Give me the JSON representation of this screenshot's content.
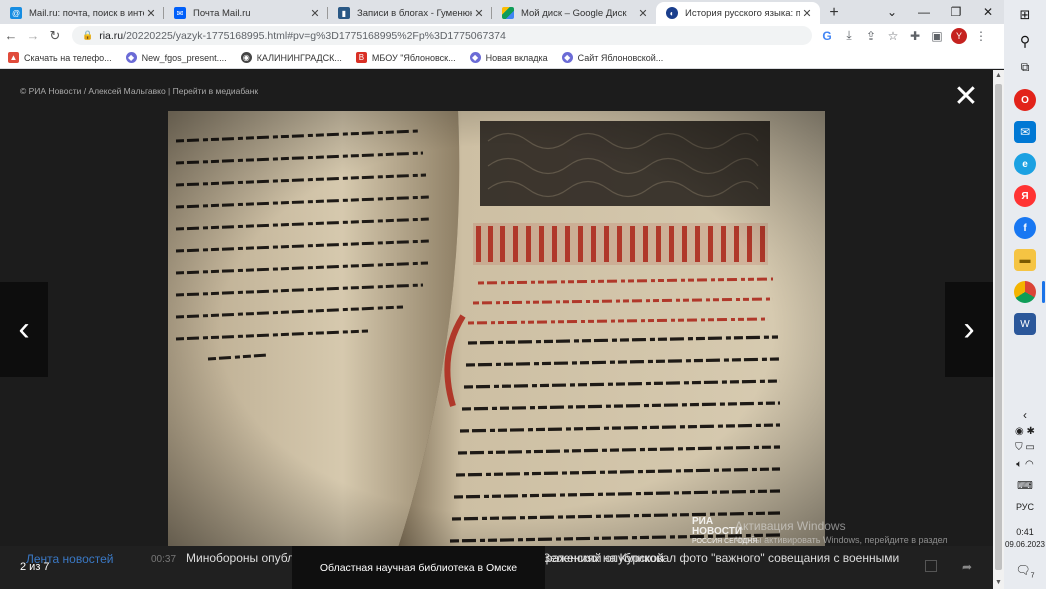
{
  "browser": {
    "tabs": [
      {
        "title": "Mail.ru: почта, поиск в интерне",
        "favicon": "mailru-icon",
        "color": "#168de2"
      },
      {
        "title": "Почта Mail.ru",
        "favicon": "mail-envelope-icon",
        "color": "#005ff9"
      },
      {
        "title": "Записи в блогах - Гуменюк Мар",
        "favicon": "blog-icon",
        "color": "#2a5885"
      },
      {
        "title": "Мой диск – Google Диск",
        "favicon": "google-drive-icon",
        "color": "#0f9d58"
      },
      {
        "title": "История русского языка: прои",
        "favicon": "ria-icon",
        "color": "#1a3e8c"
      }
    ],
    "active_tab": 4,
    "url_host": "ria.ru",
    "url_path": "/20220225/yazyk-1775168995.html#pv=g%3D1775168995%2Fp%3D1775067374",
    "profile_letter": "Y",
    "bookmarks": [
      {
        "label": "Скачать на телефо...",
        "color": "#e04b3b"
      },
      {
        "label": "New_fgos_present....",
        "color": "#6b6bd6"
      },
      {
        "label": "КАЛИНИНГРАДСК...",
        "color": "#444444"
      },
      {
        "label": "МБОУ \"Яблоновск...",
        "color": "#d93025"
      },
      {
        "label": "Новая вкладка",
        "color": "#6b6bd6"
      },
      {
        "label": "Сайт Яблоновской...",
        "color": "#6b6bd6"
      }
    ]
  },
  "gallery": {
    "credit": "© РИА Новости / Алексей Мальгавко | Перейти в медиабанк",
    "counter": "2 из 7",
    "caption": "Областная научная библиотека в Омске",
    "watermark_line1": "РИА",
    "watermark_line2": "НОВОСТИ",
    "watermark_line3": "РОССИЯ СЕГОДНЯ"
  },
  "windows_activation": {
    "title": "Активация Windows",
    "text": "Чтобы активировать Windows, перейдите в раздел \"Параметры\"."
  },
  "ticker": {
    "feed_label": "Лента новостей",
    "time": "00:37",
    "news1": "Минобороны опубликовало архивные документы о воздушных сражениях на Курской",
    "news2": "Зеленский опубликовал фото \"важного\" совещания с военными"
  },
  "taskbar": {
    "lang": "РУС",
    "time": "0:41",
    "date": "09.06.2023",
    "notifications": "7"
  }
}
